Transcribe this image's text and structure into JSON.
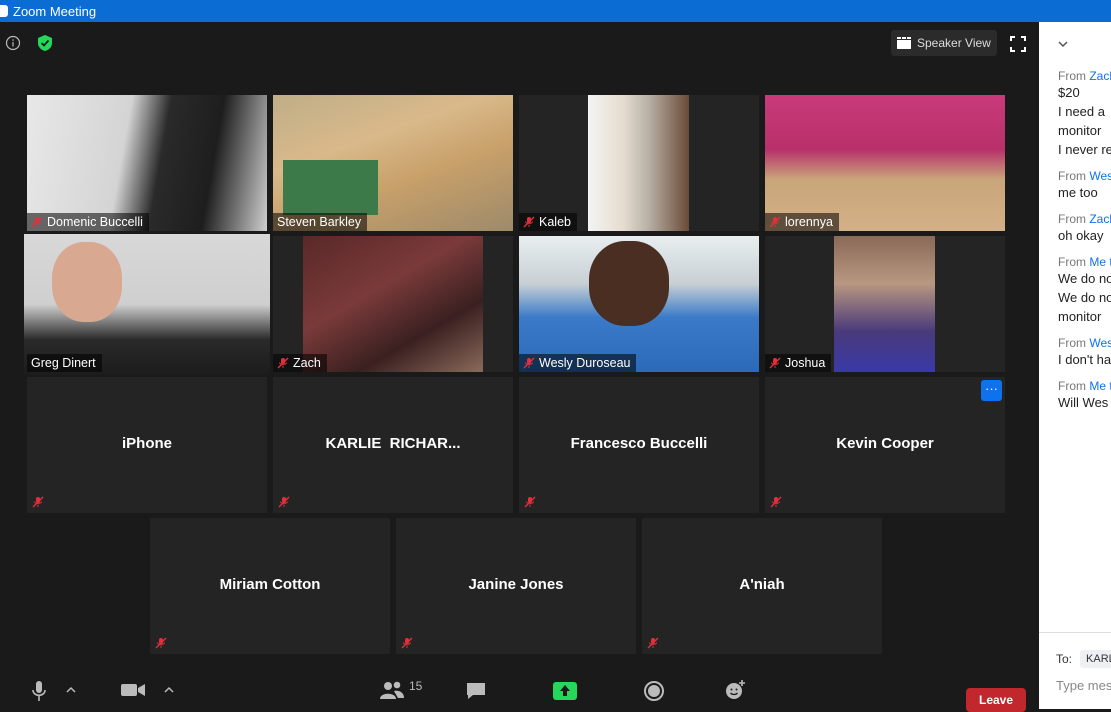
{
  "window": {
    "title": "Zoom Meeting"
  },
  "topbar": {
    "speaker_view_label": "Speaker View"
  },
  "video_tiles": [
    {
      "name": "Domenic Buccelli",
      "muted": true
    },
    {
      "name": "Steven Barkley",
      "muted": false
    },
    {
      "name": "Kaleb",
      "muted": true
    },
    {
      "name": "lorennya",
      "muted": true
    },
    {
      "name": "Greg Dinert",
      "muted": false,
      "active": true
    },
    {
      "name": "Zach",
      "muted": true
    },
    {
      "name": "Wesly Duroseau",
      "muted": true
    },
    {
      "name": "Joshua",
      "muted": true
    }
  ],
  "name_tiles": [
    {
      "name": "iPhone"
    },
    {
      "name": "KARLIE  RICHAR..."
    },
    {
      "name": "Francesco Buccelli"
    },
    {
      "name": "Kevin Cooper",
      "more_label": "···"
    },
    {
      "name": "Miriam Cotton"
    },
    {
      "name": "Janine Jones"
    },
    {
      "name": "A'niah"
    }
  ],
  "toolbar": {
    "participant_count": "15",
    "leave_label": "Leave"
  },
  "chat": {
    "messages": [
      {
        "from_prefix": "From ",
        "from_name": "Zach",
        "lines": [
          "$20",
          "I need a",
          "monitor",
          "I never re"
        ]
      },
      {
        "from_prefix": "From ",
        "from_name": "Wes",
        "lines": [
          "me too"
        ]
      },
      {
        "from_prefix": "From ",
        "from_name": "Zach",
        "lines": [
          "oh okay"
        ]
      },
      {
        "from_prefix": "From ",
        "from_name": "Me t",
        "lines": [
          "We do no",
          "We do no",
          "monitor"
        ]
      },
      {
        "from_prefix": "From ",
        "from_name": "Wes",
        "lines": [
          "I don't ha"
        ]
      },
      {
        "from_prefix": "From ",
        "from_name": "Me t",
        "lines": [
          "Will Wes"
        ]
      }
    ],
    "to_label": "To:",
    "to_recipient": "KARL",
    "input_placeholder": "Type mes"
  }
}
